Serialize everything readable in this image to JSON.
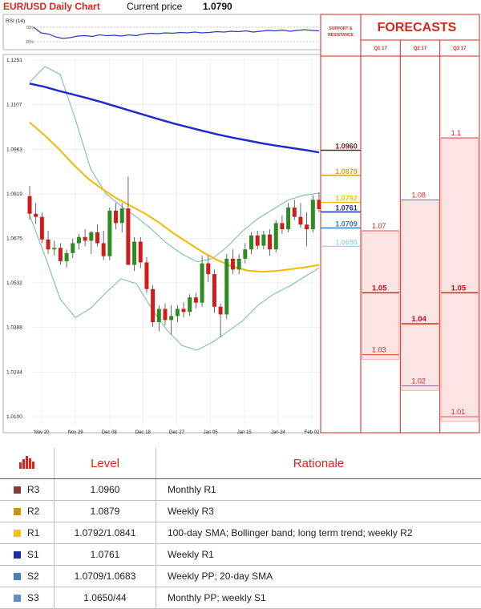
{
  "header": {
    "title": "EUR/USD Daily Chart",
    "price_label": "Current price",
    "price_value": "1.0790"
  },
  "rsi": {
    "label": "RSI (14)",
    "upper": "70%",
    "lower": "30%",
    "values": [
      72,
      58,
      55,
      48,
      44,
      46,
      50,
      51,
      49,
      53,
      51,
      52,
      50,
      53,
      51,
      55,
      57,
      56,
      58,
      57,
      59,
      58,
      60,
      58,
      59,
      61,
      60,
      62,
      61,
      63,
      60,
      62,
      64,
      63,
      65,
      62,
      64,
      66,
      64,
      63
    ]
  },
  "panel_labels": {
    "support_resistance": "SUPPORT & RESISTANCE",
    "forecasts_title": "FORECASTS"
  },
  "chart_data": {
    "type": "candlestick",
    "ylim": [
      1.01,
      1.1251
    ],
    "yticks": [
      "1.1251",
      "1.1107",
      "1.0963",
      "1.0819",
      "1.0675",
      "1.0532",
      "1.0388",
      "1.0244",
      "1.0100"
    ],
    "xticks": [
      "Nov 20",
      "Nov 29",
      "Dec 08",
      "Dec 18",
      "Dec 27",
      "Jan 05",
      "Jan 15",
      "Jan 24",
      "Feb 02"
    ],
    "candles": [
      [
        1.0812,
        1.0845,
        1.0735,
        1.0755
      ],
      [
        1.0755,
        1.079,
        1.0722,
        1.0745
      ],
      [
        1.0745,
        1.0758,
        1.066,
        1.0672
      ],
      [
        1.0672,
        1.07,
        1.0625,
        1.064
      ],
      [
        1.064,
        1.0668,
        1.062,
        1.0645
      ],
      [
        1.0645,
        1.066,
        1.059,
        1.0602
      ],
      [
        1.0602,
        1.064,
        1.0582,
        1.0628
      ],
      [
        1.0628,
        1.0675,
        1.0612,
        1.066
      ],
      [
        1.066,
        1.069,
        1.064,
        1.068
      ],
      [
        1.068,
        1.0705,
        1.065,
        1.0668
      ],
      [
        1.0668,
        1.07,
        1.0625,
        1.0695
      ],
      [
        1.0695,
        1.072,
        1.065,
        1.066
      ],
      [
        1.066,
        1.07,
        1.0605,
        1.0618
      ],
      [
        1.0618,
        1.0775,
        1.0605,
        1.0765
      ],
      [
        1.0765,
        1.079,
        1.0705,
        1.0725
      ],
      [
        1.0725,
        1.079,
        1.0695,
        1.0772
      ],
      [
        1.0772,
        1.0875,
        1.066,
        1.059
      ],
      [
        1.059,
        1.068,
        1.057,
        1.0665
      ],
      [
        1.0665,
        1.068,
        1.058,
        1.0598
      ],
      [
        1.0598,
        1.0615,
        1.05,
        1.0512
      ],
      [
        1.0512,
        1.0525,
        1.039,
        1.0405
      ],
      [
        1.0405,
        1.046,
        1.0375,
        1.0448
      ],
      [
        1.0448,
        1.0465,
        1.0395,
        1.0412
      ],
      [
        1.0412,
        1.046,
        1.0365,
        1.0425
      ],
      [
        1.0425,
        1.046,
        1.0405,
        1.0448
      ],
      [
        1.0448,
        1.047,
        1.042,
        1.0438
      ],
      [
        1.0438,
        1.0495,
        1.0425,
        1.0485
      ],
      [
        1.0485,
        1.05,
        1.045,
        1.0468
      ],
      [
        1.0468,
        1.062,
        1.0455,
        1.0595
      ],
      [
        1.0595,
        1.062,
        1.0535,
        1.056
      ],
      [
        1.056,
        1.0575,
        1.0435,
        1.0455
      ],
      [
        1.0455,
        1.0465,
        1.0355,
        1.043
      ],
      [
        1.043,
        1.0625,
        1.0415,
        1.061
      ],
      [
        1.061,
        1.064,
        1.056,
        1.0575
      ],
      [
        1.0575,
        1.0625,
        1.056,
        1.061
      ],
      [
        1.061,
        1.066,
        1.0595,
        1.064
      ],
      [
        1.064,
        1.0695,
        1.0625,
        1.0685
      ],
      [
        1.0685,
        1.07,
        1.064,
        1.0652
      ],
      [
        1.0652,
        1.07,
        1.064,
        1.0688
      ],
      [
        1.0688,
        1.0705,
        1.062,
        1.064
      ],
      [
        1.064,
        1.0735,
        1.063,
        1.0725
      ],
      [
        1.0725,
        1.075,
        1.069,
        1.0705
      ],
      [
        1.0705,
        1.079,
        1.0695,
        1.0775
      ],
      [
        1.0775,
        1.08,
        1.0735,
        1.0745
      ],
      [
        1.0745,
        1.079,
        1.071,
        1.072
      ],
      [
        1.072,
        1.076,
        1.065,
        1.0705
      ],
      [
        1.0705,
        1.0815,
        1.0695,
        1.08
      ],
      [
        1.08,
        1.0825,
        1.076,
        1.077
      ]
    ],
    "sma200": [
      1.1175,
      1.1165,
      1.1152,
      1.114,
      1.1128,
      1.1115,
      1.1101,
      1.1087,
      1.1073,
      1.1059,
      1.1046,
      1.1034,
      1.1022,
      1.1011,
      1.1001,
      1.0992,
      1.0983,
      1.0975,
      1.0968,
      1.0961,
      1.0953
    ],
    "sma100": [
      1.105,
      1.101,
      1.0965,
      1.0915,
      1.087,
      1.0835,
      1.0805,
      1.078,
      1.0755,
      1.0725,
      1.069,
      1.066,
      1.063,
      1.0605,
      1.0585,
      1.0572,
      1.0568,
      1.057,
      1.0576,
      1.0582,
      1.059
    ],
    "bb_upper": [
      1.118,
      1.123,
      1.1205,
      1.106,
      1.09,
      1.082,
      1.078,
      1.0745,
      1.0705,
      1.066,
      1.0625,
      1.06,
      1.061,
      1.065,
      1.07,
      1.074,
      1.077,
      1.08,
      1.0815,
      1.0822
    ],
    "bb_lower": [
      1.075,
      1.062,
      1.048,
      1.042,
      1.045,
      1.05,
      1.0545,
      1.053,
      1.045,
      1.038,
      1.033,
      1.0315,
      1.034,
      1.0375,
      1.041,
      1.046,
      1.0495,
      1.052,
      1.055,
      1.058
    ],
    "sr_levels": [
      {
        "value": "1.0960",
        "color": "#6b2226"
      },
      {
        "value": "1.0879",
        "color": "#d6a21a"
      },
      {
        "value": "1.0792",
        "color": "#f2c500"
      },
      {
        "value": "1.0761",
        "color": "#1f2aa8"
      },
      {
        "value": "1.0709",
        "color": "#3c78b5"
      },
      {
        "value": "1.0650",
        "color": "#a8d4e0"
      }
    ],
    "forecasts": [
      {
        "label": "Q1 17",
        "values": [
          "1.07",
          "1.05",
          "1.03"
        ],
        "bold": "1.05"
      },
      {
        "label": "Q2 17",
        "values": [
          "1.08",
          "1.04",
          "1.02"
        ],
        "bold": "1.04"
      },
      {
        "label": "Q3 17",
        "values": [
          "1.1",
          "1.05",
          "1.01"
        ],
        "bold": "1.05"
      }
    ]
  },
  "table": {
    "headers": {
      "level": "Level",
      "rationale": "Rationale"
    },
    "rows": [
      {
        "name": "R3",
        "level": "1.0960",
        "rationale": "Monthly R1",
        "color": "#8b3a3a"
      },
      {
        "name": "R2",
        "level": "1.0879",
        "rationale": "Weekly R3",
        "color": "#c9960c"
      },
      {
        "name": "R1",
        "level": "1.0792/1.0841",
        "rationale": "100-day SMA; Bollinger band; long term trend; weekly R2",
        "color": "#f2c500"
      },
      {
        "name": "S1",
        "level": "1.0761",
        "rationale": "Weekly R1",
        "color": "#1f2aa8"
      },
      {
        "name": "S2",
        "level": "1.0709/1.0683",
        "rationale": "Weekly PP; 20-day SMA",
        "color": "#4a7fbf"
      },
      {
        "name": "S3",
        "level": "1.0650/44",
        "rationale": "Monthly PP; weekly S1",
        "color": "#5b8fc7"
      }
    ]
  }
}
